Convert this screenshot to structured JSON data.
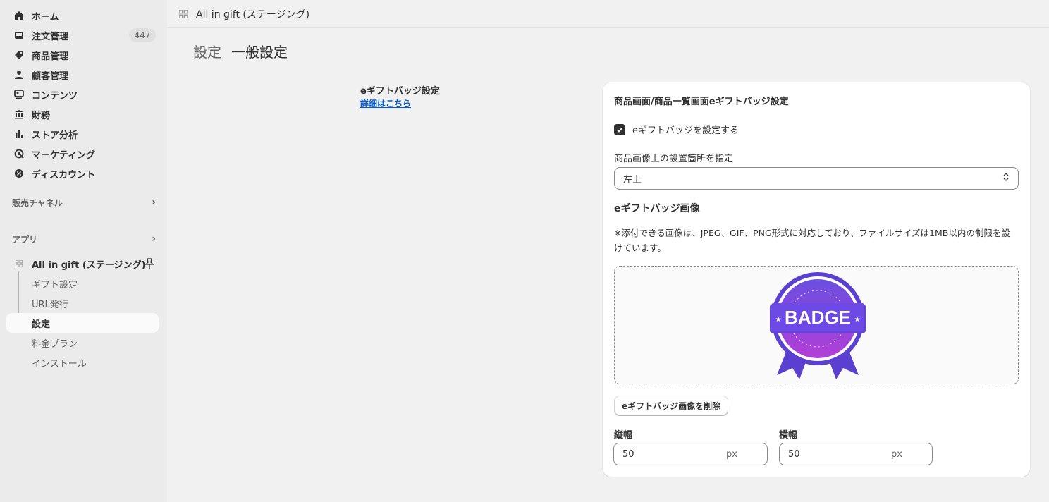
{
  "sidebar": {
    "nav": [
      {
        "label": "ホーム",
        "icon": "home-icon"
      },
      {
        "label": "注文管理",
        "icon": "inbox-icon",
        "badge": "447"
      },
      {
        "label": "商品管理",
        "icon": "tag-icon"
      },
      {
        "label": "顧客管理",
        "icon": "person-icon"
      },
      {
        "label": "コンテンツ",
        "icon": "content-icon"
      },
      {
        "label": "財務",
        "icon": "bank-icon"
      },
      {
        "label": "ストア分析",
        "icon": "bar-chart-icon"
      },
      {
        "label": "マーケティング",
        "icon": "target-icon"
      },
      {
        "label": "ディスカウント",
        "icon": "discount-icon"
      }
    ],
    "sales_channels": "販売チャネル",
    "apps": "アプリ",
    "app_name": "All in gift (ステージング)",
    "app_sub": [
      "ギフト設定",
      "URL発行",
      "設定",
      "料金プラン",
      "インストール"
    ]
  },
  "topbar": {
    "title": "All in gift (ステージング)"
  },
  "breadcrumb": {
    "parent": "設定",
    "current": "一般設定"
  },
  "section": {
    "title": "eギフトバッジ設定",
    "link": "詳細はこちら"
  },
  "card": {
    "title": "商品画面/商品一覧画面eギフトバッジ設定",
    "checkbox_label": "eギフトバッジを設定する",
    "checkbox_checked": true,
    "position_label": "商品画像上の設置箇所を指定",
    "position_value": "左上",
    "image_heading": "eギフトバッジ画像",
    "note": "※添付できる画像は、JPEG、GIF、PNG形式に対応しており、ファイルサイズは1MB以内の制限を設けています。",
    "badge_text": "BADGE",
    "delete_button": "eギフトバッジ画像を削除",
    "height_label": "縦幅",
    "height_value": "50",
    "width_label": "横幅",
    "width_value": "50",
    "unit": "px"
  },
  "colors": {
    "accent_link": "#005bd3",
    "badge_purple": "#7b3fe4"
  }
}
